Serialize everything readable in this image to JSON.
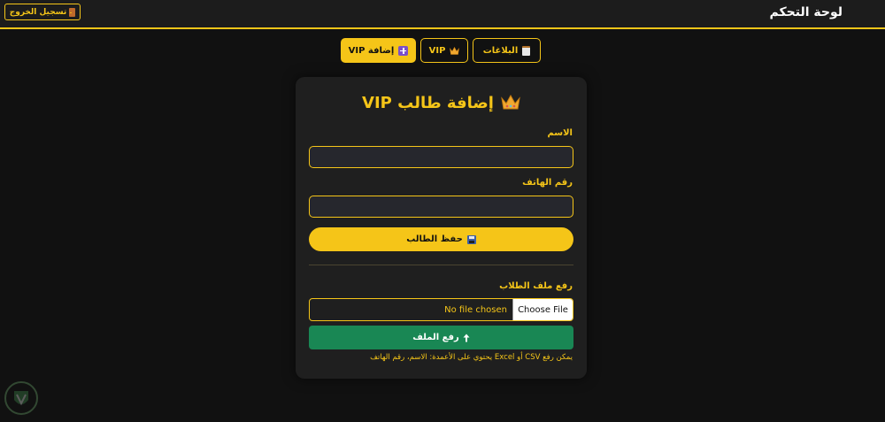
{
  "header": {
    "brand": "لوحة التحكم",
    "logout_label": "تسجيل الخروج",
    "logout_icon": "door-icon"
  },
  "tabs": [
    {
      "label": "البلاغات",
      "icon": "clipboard-icon",
      "active": false
    },
    {
      "label": "VIP",
      "icon": "crown-icon",
      "active": false
    },
    {
      "label": "إضافة VIP",
      "icon": "plus-icon",
      "active": true
    }
  ],
  "form": {
    "title": "إضافة طالب VIP",
    "title_icon": "crown-icon",
    "name_label": "الاسم",
    "name_value": "",
    "phone_label": "رقم الهاتف",
    "phone_value": "",
    "save_label": "حفظ الطالب",
    "save_icon": "floppy-disk-icon"
  },
  "upload": {
    "label": "رفع ملف الطلاب",
    "choose_label": "Choose File",
    "file_status": "No file chosen",
    "upload_label": "رفع الملف",
    "upload_icon": "up-arrow-icon",
    "help": "يمكن رفع CSV أو Excel يحتوي على الأعمدة: الاسم، رقم الهاتف"
  },
  "colors": {
    "accent": "#f5c518",
    "background": "#111111",
    "card": "#1f1f1f",
    "upload_button": "#198754"
  }
}
